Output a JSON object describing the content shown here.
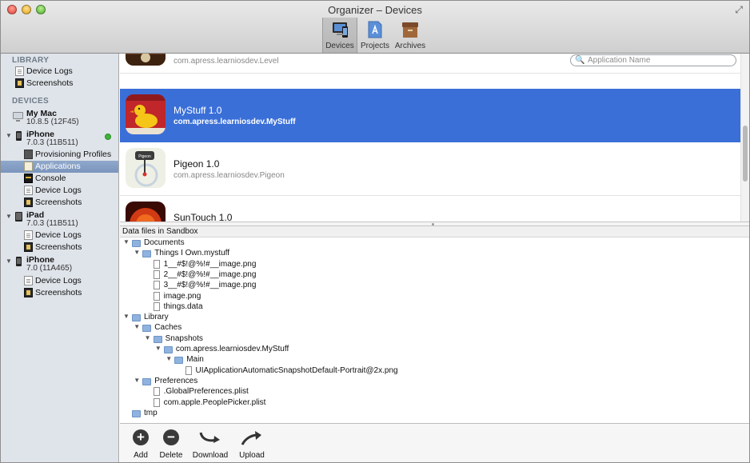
{
  "window": {
    "title": "Organizer – Devices"
  },
  "toolbar": {
    "buttons": [
      {
        "label": "Devices",
        "icon": "device-icon",
        "selected": true
      },
      {
        "label": "Projects",
        "icon": "projects-icon",
        "selected": false
      },
      {
        "label": "Archives",
        "icon": "archives-icon",
        "selected": false
      }
    ]
  },
  "search": {
    "placeholder": "Application Name"
  },
  "sidebar": {
    "library_header": "LIBRARY",
    "library_items": [
      "Device Logs",
      "Screenshots"
    ],
    "devices_header": "DEVICES",
    "my_mac": {
      "name": "My Mac",
      "version": "10.8.5 (12F45)"
    },
    "iphone1": {
      "name": "iPhone",
      "version": "7.0.3 (11B511)",
      "items": [
        "Provisioning Profiles",
        "Applications",
        "Console",
        "Device Logs",
        "Screenshots"
      ],
      "selected": "Applications"
    },
    "ipad": {
      "name": "iPad",
      "version": "7.0.3 (11B511)",
      "items": [
        "Device Logs",
        "Screenshots"
      ]
    },
    "iphone2": {
      "name": "iPhone",
      "version": "7.0 (11A465)",
      "items": [
        "Device Logs",
        "Screenshots"
      ]
    }
  },
  "apps": [
    {
      "name": "",
      "bundle_id": "com.apress.learniosdev.Level"
    },
    {
      "name": "MyStuff 1.0",
      "bundle_id": "com.apress.learniosdev.MyStuff",
      "selected": true
    },
    {
      "name": "Pigeon 1.0",
      "bundle_id": "com.apress.learniosdev.Pigeon",
      "badge": "Pigeon"
    },
    {
      "name": "SunTouch 1.0",
      "bundle_id": ""
    }
  ],
  "sandbox": {
    "header": "Data files in Sandbox",
    "tree": [
      {
        "label": "Documents",
        "type": "folder",
        "depth": 0
      },
      {
        "label": "Things I Own.mystuff",
        "type": "folder",
        "depth": 1
      },
      {
        "label": "1__#$!@%!#__image.png",
        "type": "file",
        "depth": 2
      },
      {
        "label": "2__#$!@%!#__image.png",
        "type": "file",
        "depth": 2
      },
      {
        "label": "3__#$!@%!#__image.png",
        "type": "file",
        "depth": 2
      },
      {
        "label": "image.png",
        "type": "file",
        "depth": 2
      },
      {
        "label": "things.data",
        "type": "file",
        "depth": 2
      },
      {
        "label": "Library",
        "type": "folder",
        "depth": 0
      },
      {
        "label": "Caches",
        "type": "folder",
        "depth": 1
      },
      {
        "label": "Snapshots",
        "type": "folder",
        "depth": 2
      },
      {
        "label": "com.apress.learniosdev.MyStuff",
        "type": "folder",
        "depth": 3
      },
      {
        "label": "Main",
        "type": "folder",
        "depth": 4
      },
      {
        "label": "UIApplicationAutomaticSnapshotDefault-Portrait@2x.png",
        "type": "file",
        "depth": 5
      },
      {
        "label": "Preferences",
        "type": "folder",
        "depth": 1
      },
      {
        "label": ".GlobalPreferences.plist",
        "type": "file",
        "depth": 2
      },
      {
        "label": "com.apple.PeoplePicker.plist",
        "type": "file",
        "depth": 2
      },
      {
        "label": "tmp",
        "type": "folder",
        "depth": 0,
        "collapsed": true
      }
    ]
  },
  "bottombar": {
    "add_label": "Add",
    "delete_label": "Delete",
    "download_label": "Download",
    "upload_label": "Upload"
  }
}
